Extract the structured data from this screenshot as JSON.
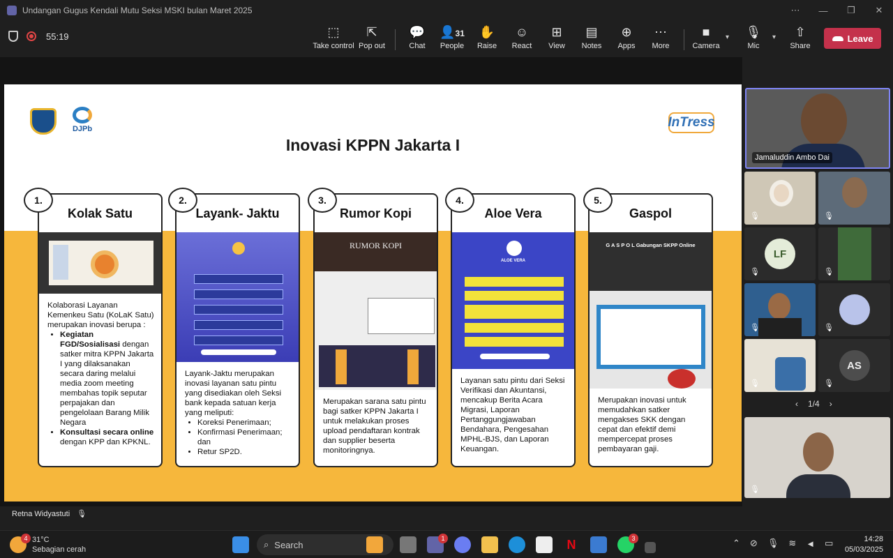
{
  "window": {
    "title": "Undangan Gugus Kendali Mutu Seksi MSKI bulan Maret 2025"
  },
  "meeting": {
    "timer": "55:19"
  },
  "toolbar": {
    "take_control": "Take control",
    "pop_out": "Pop out",
    "chat": "Chat",
    "people": "People",
    "people_count": "31",
    "raise": "Raise",
    "react": "React",
    "view": "View",
    "notes": "Notes",
    "apps": "Apps",
    "more": "More",
    "camera": "Camera",
    "mic": "Mic",
    "share": "Share",
    "leave": "Leave"
  },
  "slide": {
    "title": "Inovasi KPPN Jakarta I",
    "logo_djpb": "DJPb",
    "logo_intress": "InTress",
    "cards": [
      {
        "num": "1.",
        "title": "Kolak Satu",
        "intro": "Kolaborasi Layanan Kemenkeu Satu (KoLaK Satu) merupakan inovasi berupa :",
        "b1_bold": "Kegiatan FGD/Sosialisasi",
        "b1_rest": " dengan satker mitra KPPN Jakarta I yang dilaksanakan secara daring melalui media zoom meeting membahas topik seputar perpajakan dan pengelolaan Barang Milik Negara",
        "b2_bold": "Konsultasi secara online",
        "b2_rest": " dengan KPP dan KPKNL."
      },
      {
        "num": "2.",
        "title": "Layank- Jaktu",
        "intro": "Layank-Jaktu merupakan inovasi layanan satu pintu yang disediakan oleh Seksi bank kepada satuan kerja yang meliputi:",
        "items": [
          "Koreksi Penerimaan;",
          "Konfirmasi Penerimaan; dan",
          "Retur SP2D."
        ]
      },
      {
        "num": "3.",
        "title": "Rumor Kopi",
        "text": "Merupakan sarana satu pintu bagi satker KPPN Jakarta I untuk melakukan proses upload pendaftaran kontrak dan supplier beserta monitoringnya.",
        "shot_label": "RUMOR KOPI"
      },
      {
        "num": "4.",
        "title": "Aloe Vera",
        "text": "Layanan satu pintu dari Seksi Verifikasi dan Akuntansi, mencakup Berita Acara Migrasi, Laporan Pertanggungjawaban Bendahara, Pengesahan MPHL-BJS, dan Laporan Keuangan.",
        "shot_label": "ALOE VERA"
      },
      {
        "num": "5.",
        "title": "Gaspol",
        "text": "Merupakan inovasi untuk memudahkan satker mengakses SKK dengan cepat dan efektif demi mempercepat proses pembayaran gaji.",
        "shot_label": "G A S P O L  Gabungan SKPP Online"
      }
    ]
  },
  "participants": {
    "main_name": "Jamaluddin Ambo Dai",
    "lf_initials": "LF",
    "as_initials": "AS",
    "pager": "1/4"
  },
  "speaker": {
    "name": "Retna Widyastuti"
  },
  "taskbar": {
    "temp": "31°C",
    "weather": "Sebagian cerah",
    "search": "Search",
    "weather_badge": "4",
    "teams_badge": "1",
    "whatsapp_badge": "3",
    "time": "14:28",
    "date": "05/03/2025"
  }
}
